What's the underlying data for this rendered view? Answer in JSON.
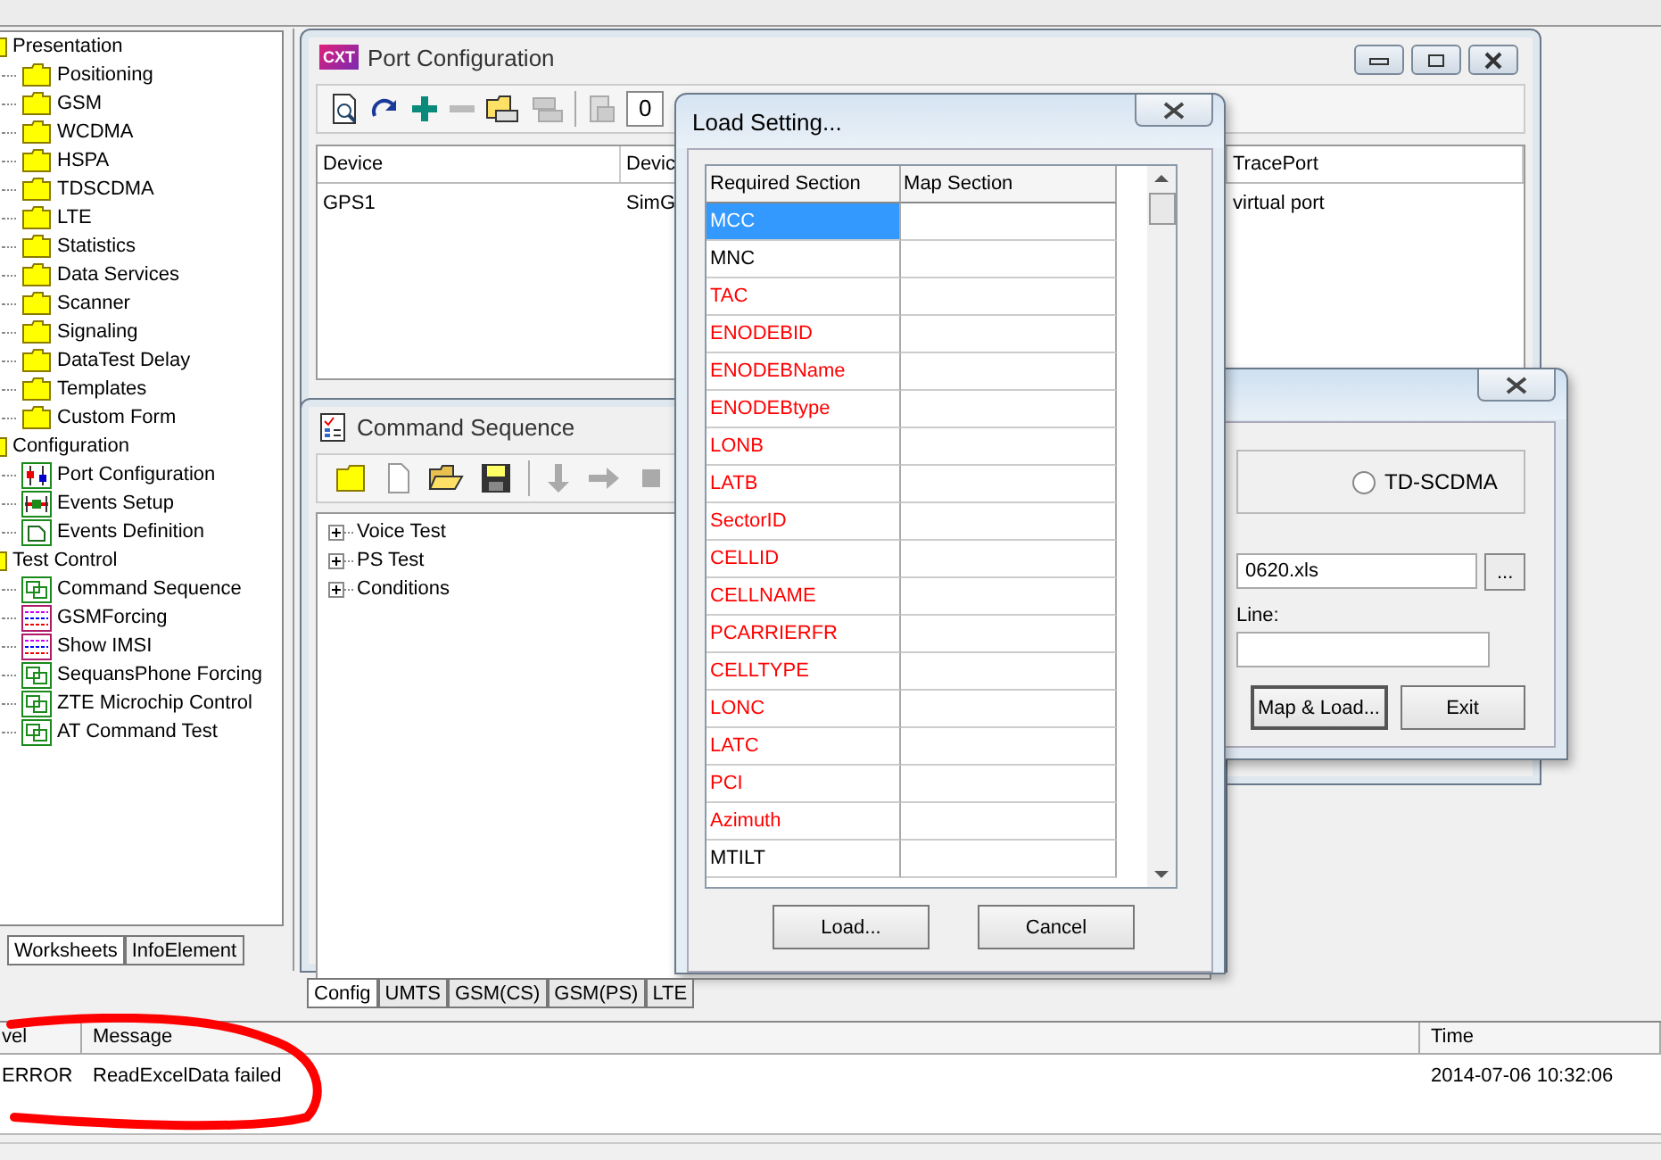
{
  "navigator": {
    "tree": [
      {
        "label": "Presentation",
        "children": [
          {
            "label": "Positioning",
            "kind": "folder"
          },
          {
            "label": "GSM",
            "kind": "folder"
          },
          {
            "label": "WCDMA",
            "kind": "folder"
          },
          {
            "label": "HSPA",
            "kind": "folder"
          },
          {
            "label": "TDSCDMA",
            "kind": "folder"
          },
          {
            "label": "LTE",
            "kind": "folder"
          },
          {
            "label": "Statistics",
            "kind": "folder"
          },
          {
            "label": "Data Services",
            "kind": "folder"
          },
          {
            "label": "Scanner",
            "kind": "folder"
          },
          {
            "label": "Signaling",
            "kind": "folder"
          },
          {
            "label": "DataTest Delay",
            "kind": "folder"
          },
          {
            "label": "Templates",
            "kind": "folder"
          },
          {
            "label": "Custom Form",
            "kind": "folder"
          }
        ]
      },
      {
        "label": "Configuration",
        "children": [
          {
            "label": "Port Configuration",
            "kind": "port"
          },
          {
            "label": "Events Setup",
            "kind": "events"
          },
          {
            "label": "Events Definition",
            "kind": "definition"
          }
        ]
      },
      {
        "label": "Test Control",
        "children": [
          {
            "label": "Command Sequence",
            "kind": "sequence"
          },
          {
            "label": "GSMForcing",
            "kind": "grid"
          },
          {
            "label": "Show IMSI",
            "kind": "grid"
          },
          {
            "label": "SequansPhone Forcing",
            "kind": "sequence"
          },
          {
            "label": "ZTE Microchip Control",
            "kind": "sequence"
          },
          {
            "label": "AT Command Test",
            "kind": "sequence"
          }
        ]
      }
    ],
    "tabs": [
      {
        "label": "Worksheets",
        "selected": true
      },
      {
        "label": "InfoElement",
        "selected": false
      }
    ]
  },
  "port_configuration": {
    "title": "Port Configuration",
    "logo": "CXT",
    "combo_value": "0",
    "columns": [
      "Device",
      "Devic",
      "TracePort"
    ],
    "rows": [
      [
        "GPS1",
        "SimG",
        "virtual port"
      ]
    ]
  },
  "command_sequence": {
    "title": "Command Sequence",
    "tree": [
      {
        "label": "Voice Test",
        "expanded": false
      },
      {
        "label": "PS Test",
        "expanded": false
      },
      {
        "label": "Conditions",
        "expanded": false
      }
    ]
  },
  "map_dialog": {
    "radio": {
      "label": "TD-SCDMA",
      "selected": false
    },
    "file_value": "0620.xls",
    "browse_button": "...",
    "line_label": "Line:",
    "buttons": [
      "Map & Load...",
      "Exit"
    ]
  },
  "load_setting": {
    "title": "Load Setting...",
    "columns": [
      "Required Section",
      "Map Section"
    ],
    "rows": [
      {
        "name": "MCC",
        "required": false,
        "selected": true
      },
      {
        "name": "MNC",
        "required": false,
        "selected": false
      },
      {
        "name": "TAC",
        "required": true,
        "selected": false
      },
      {
        "name": "ENODEBID",
        "required": true,
        "selected": false
      },
      {
        "name": "ENODEBName",
        "required": true,
        "selected": false
      },
      {
        "name": "ENODEBtype",
        "required": true,
        "selected": false
      },
      {
        "name": "LONB",
        "required": true,
        "selected": false
      },
      {
        "name": "LATB",
        "required": true,
        "selected": false
      },
      {
        "name": "SectorID",
        "required": true,
        "selected": false
      },
      {
        "name": "CELLID",
        "required": true,
        "selected": false
      },
      {
        "name": "CELLNAME",
        "required": true,
        "selected": false
      },
      {
        "name": "PCARRIERFR",
        "required": true,
        "selected": false
      },
      {
        "name": "CELLTYPE",
        "required": true,
        "selected": false
      },
      {
        "name": "LONC",
        "required": true,
        "selected": false
      },
      {
        "name": "LATC",
        "required": true,
        "selected": false
      },
      {
        "name": "PCI",
        "required": true,
        "selected": false
      },
      {
        "name": "Azimuth",
        "required": true,
        "selected": false
      },
      {
        "name": "MTILT",
        "required": false,
        "selected": false
      }
    ],
    "buttons": [
      "Load...",
      "Cancel"
    ]
  },
  "sheet_tabs": [
    {
      "label": "Config",
      "selected": true
    },
    {
      "label": "UMTS",
      "selected": false
    },
    {
      "label": "GSM(CS)",
      "selected": false
    },
    {
      "label": "GSM(PS)",
      "selected": false
    },
    {
      "label": "LTE",
      "selected": false
    }
  ],
  "log": {
    "columns": [
      "vel",
      "Message",
      "Time"
    ],
    "rows": [
      [
        "ERROR",
        "ReadExcelData failed",
        "2014-07-06 10:32:06"
      ]
    ]
  }
}
